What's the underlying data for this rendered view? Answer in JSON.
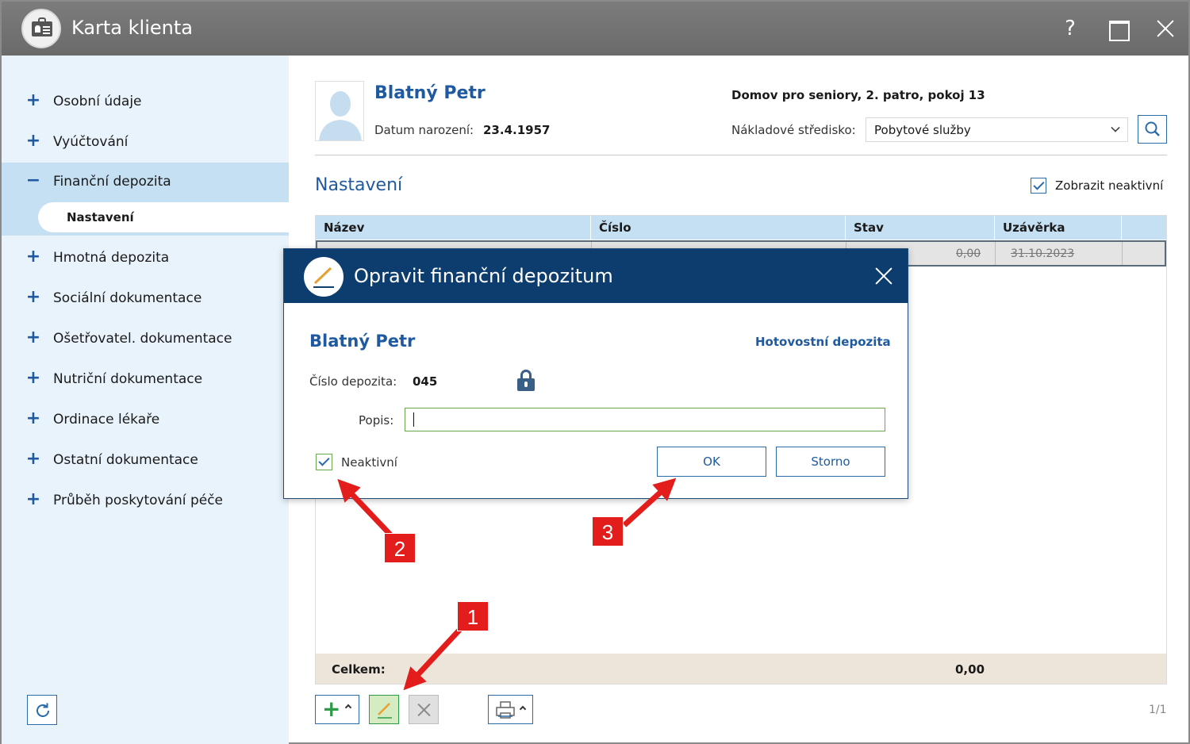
{
  "window": {
    "title": "Karta klienta",
    "help_label": "?"
  },
  "sidebar": {
    "items": [
      {
        "sign": "+",
        "label": "Osobní údaje"
      },
      {
        "sign": "+",
        "label": "Vyúčtování"
      },
      {
        "sign": "−",
        "label": "Finanční depozita"
      },
      {
        "sign": "+",
        "label": "Hmotná depozita"
      },
      {
        "sign": "+",
        "label": "Sociální dokumentace"
      },
      {
        "sign": "+",
        "label": "Ošetřovatel. dokumentace"
      },
      {
        "sign": "+",
        "label": "Nutriční dokumentace"
      },
      {
        "sign": "+",
        "label": "Ordinace lékaře"
      },
      {
        "sign": "+",
        "label": "Ostatní dokumentace"
      },
      {
        "sign": "+",
        "label": "Průběh poskytování péče"
      }
    ],
    "subitem": "Nastavení"
  },
  "client": {
    "name": "Blatný Petr",
    "dob_label": "Datum narození:",
    "dob_value": "23.4.1957",
    "location": "Domov pro seniory, 2. patro, pokoj 13",
    "cost_center_label": "Nákladové středisko:",
    "cost_center_value": "Pobytové služby"
  },
  "section": {
    "title": "Nastavení",
    "show_inactive_label": "Zobrazit neaktivní",
    "show_inactive_checked": true
  },
  "grid": {
    "columns": [
      "Název",
      "Číslo",
      "Stav",
      "Uzávěrka"
    ],
    "rows": [
      {
        "stav": "0,00",
        "uzaverka": "31.10.2023",
        "inactive": true
      }
    ],
    "footer_label": "Celkem:",
    "footer_value": "0,00"
  },
  "toolbar": {
    "add_label": "+",
    "pager": "1/1"
  },
  "dialog": {
    "title": "Opravit finanční depozitum",
    "client_name": "Blatný Petr",
    "deposit_type": "Hotovostní depozita",
    "number_label": "Číslo depozita:",
    "number_value": "045",
    "popis_label": "Popis:",
    "popis_value": "",
    "inactive_label": "Neaktivní",
    "inactive_checked": true,
    "ok_label": "OK",
    "cancel_label": "Storno"
  },
  "callouts": [
    "1",
    "2",
    "3"
  ],
  "colors": {
    "accent": "#1f5aa0",
    "dialog_header": "#0d3d6e",
    "sidebar_bg": "#e9f3fb",
    "callout": "#e31c1c",
    "total_bg": "#ede5da"
  }
}
